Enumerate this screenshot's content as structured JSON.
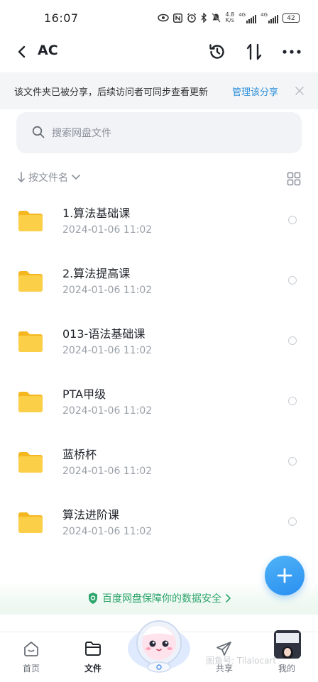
{
  "status_bar": {
    "time": "16:07",
    "net_speed_value": "4.8",
    "net_speed_unit": "K/s",
    "sim1": "4G",
    "sim2": "4G",
    "battery": "42"
  },
  "header": {
    "title": "AC",
    "icons": [
      "back-arrow",
      "history-clock",
      "transfer-arrows",
      "more-dots"
    ]
  },
  "notice": {
    "text": "该文件夹已被分享，后续访问者可同步查看更新",
    "link": "管理该分享"
  },
  "search": {
    "placeholder": "搜索网盘文件"
  },
  "sort": {
    "label": "按文件名"
  },
  "files": [
    {
      "name": "1.算法基础课",
      "date": "2024-01-06  11:02"
    },
    {
      "name": "2.算法提高课",
      "date": "2024-01-06  11:02"
    },
    {
      "name": "013-语法基础课",
      "date": "2024-01-06  11:02"
    },
    {
      "name": "PTA甲级",
      "date": "2024-01-06  11:02"
    },
    {
      "name": "蓝桥杯",
      "date": "2024-01-06  11:02"
    },
    {
      "name": "算法进阶课",
      "date": "2024-01-06  11:02"
    }
  ],
  "security_banner": {
    "text": "百度网盘保障你的数据安全"
  },
  "tabbar": {
    "tabs": [
      {
        "label": "首页"
      },
      {
        "label": "文件"
      },
      {
        "label": "共享"
      },
      {
        "label": "我的"
      }
    ],
    "active": "文件"
  },
  "watermark": "图鱼号: Tilalocart",
  "colors": {
    "accent": "#2d8fdb",
    "folder": "#f9c93a",
    "security_green": "#2ea56b",
    "fab": "#2a8ff0"
  }
}
